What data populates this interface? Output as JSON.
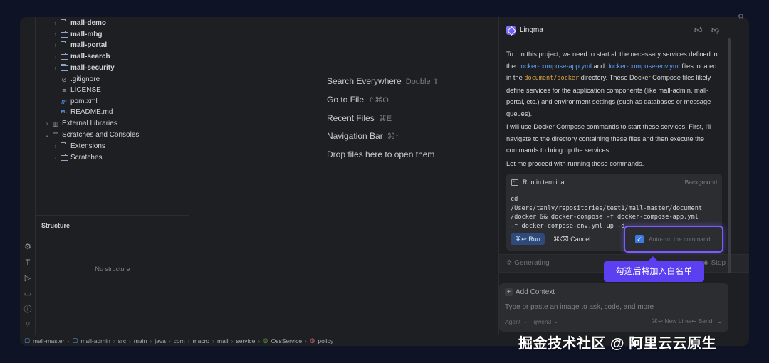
{
  "project_tree": [
    {
      "label": "mall-demo",
      "type": "folder",
      "bold": true,
      "expandable": true
    },
    {
      "label": "mall-mbg",
      "type": "folder",
      "bold": true,
      "expandable": true
    },
    {
      "label": "mall-portal",
      "type": "folder",
      "bold": true,
      "expandable": true
    },
    {
      "label": "mall-search",
      "type": "folder",
      "bold": true,
      "expandable": true
    },
    {
      "label": "mall-security",
      "type": "folder",
      "bold": true,
      "expandable": true
    },
    {
      "label": ".gitignore",
      "type": "gitignore",
      "bold": false,
      "expandable": false
    },
    {
      "label": "LICENSE",
      "type": "file",
      "bold": false,
      "expandable": false
    },
    {
      "label": "pom.xml",
      "type": "maven",
      "bold": false,
      "expandable": false
    },
    {
      "label": "README.md",
      "type": "markdown",
      "bold": false,
      "expandable": false
    },
    {
      "label": "External Libraries",
      "type": "library",
      "bold": false,
      "expandable": true
    },
    {
      "label": "Scratches and Consoles",
      "type": "scratches",
      "bold": false,
      "expandable": true
    },
    {
      "label": "Extensions",
      "type": "folder",
      "bold": false,
      "expandable": true
    },
    {
      "label": "Scratches",
      "type": "folder",
      "bold": false,
      "expandable": true
    }
  ],
  "structure": {
    "title": "Structure",
    "empty_text": "No structure"
  },
  "editor_hints": [
    {
      "label": "Search Everywhere",
      "shortcut": "Double ⇧"
    },
    {
      "label": "Go to File",
      "shortcut": "⇧⌘O"
    },
    {
      "label": "Recent Files",
      "shortcut": "⌘E"
    },
    {
      "label": "Navigation Bar",
      "shortcut": "⌘↑"
    },
    {
      "label": "Drop files here to open them",
      "shortcut": ""
    }
  ],
  "lingma": {
    "title": "Lingma",
    "msg1_a": "To run this project, we need to start all the necessary services defined in the ",
    "msg1_link1": "docker-compose-app.yml",
    "msg1_b": " and ",
    "msg1_link2": "docker-compose-env.yml",
    "msg1_c": " files located in the ",
    "msg1_path": "document/docker",
    "msg1_d": " directory. These Docker Compose files likely define services for the application components (like mall-admin, mall-portal, etc.) and environment settings (such as databases or message queues).",
    "msg2": "I will use Docker Compose commands to start these services. First, I'll navigate to the directory containing these files and then execute the commands to bring up the services.",
    "msg3": "Let me proceed with running these commands.",
    "terminal": {
      "title": "Run in terminal",
      "mode": "Background",
      "command": "cd\n/Users/tanly/repositories/test1/mall-master/document\n/docker && docker-compose -f docker-compose-app.yml\n-f docker-compose-env.yml up -d",
      "run_label": "⌘↩ Run",
      "cancel_label": "⌘⌫ Cancel"
    },
    "auto_run_label": "Auto-run the command",
    "generating_label": "Generating",
    "stop_label": "Stop",
    "tooltip": "勾选后将加入白名单",
    "input": {
      "add_context": "Add Context",
      "placeholder": "Type or paste an image to ask, code, and more",
      "agent_label": "Agent",
      "model_label": "qwen3",
      "newline_hint": "⌘↩ New Line/↩ Send"
    }
  },
  "status_bar": [
    "mall-master",
    "mall-admin",
    "src",
    "main",
    "java",
    "com",
    "macro",
    "mall",
    "service",
    "OssService",
    "policy"
  ],
  "watermark": "掘金技术社区 @ 阿里云云原生",
  "colors": {
    "accent": "#7b5cff",
    "link": "#5a9cf8",
    "path": "#d6a14a",
    "tooltip_bg": "#5b3ff0"
  }
}
